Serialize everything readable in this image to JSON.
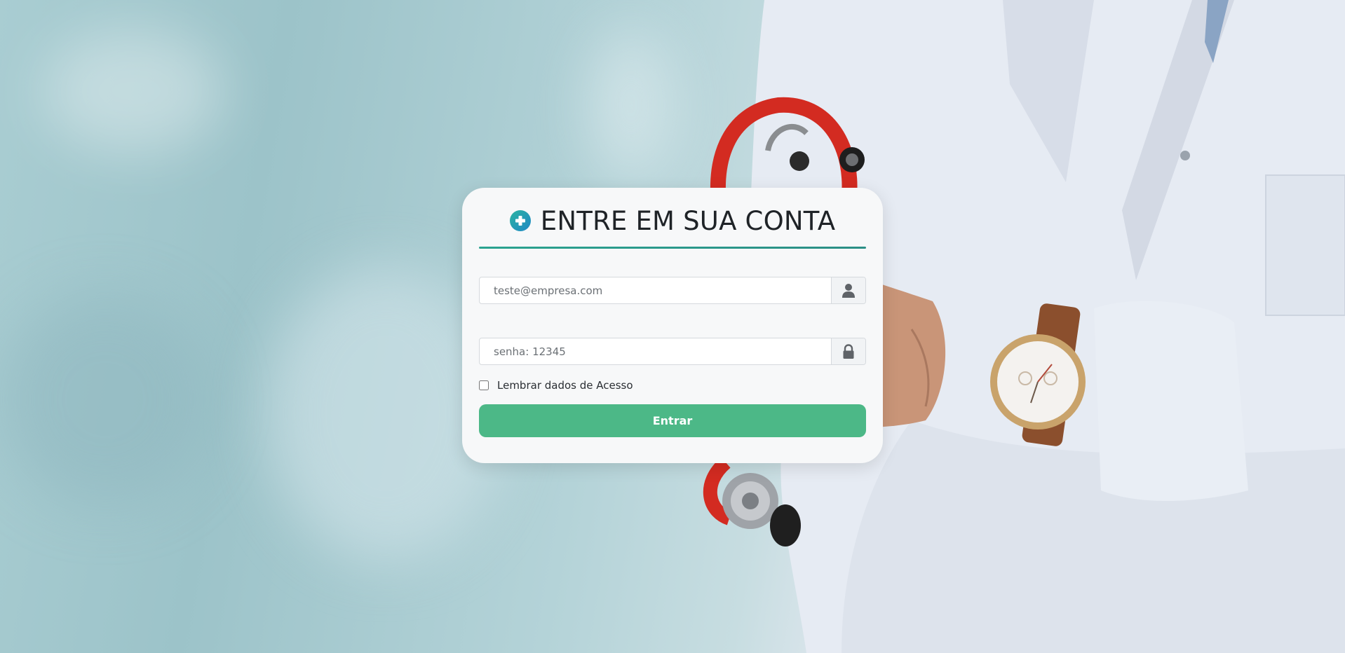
{
  "login": {
    "title": "ENTRE EM SUA CONTA",
    "title_icon": "medical-cross-icon",
    "email": {
      "placeholder": "teste@empresa.com",
      "value": "",
      "icon": "user-icon"
    },
    "password": {
      "placeholder": "senha: 12345",
      "value": "",
      "icon": "lock-icon"
    },
    "remember": {
      "label": "Lembrar dados de Acesso",
      "checked": false
    },
    "submit_label": "Entrar"
  },
  "colors": {
    "accent": "#4cb887",
    "rule": "#2aa390",
    "title_text": "#1f2327",
    "card_bg": "#f7f8f9"
  }
}
